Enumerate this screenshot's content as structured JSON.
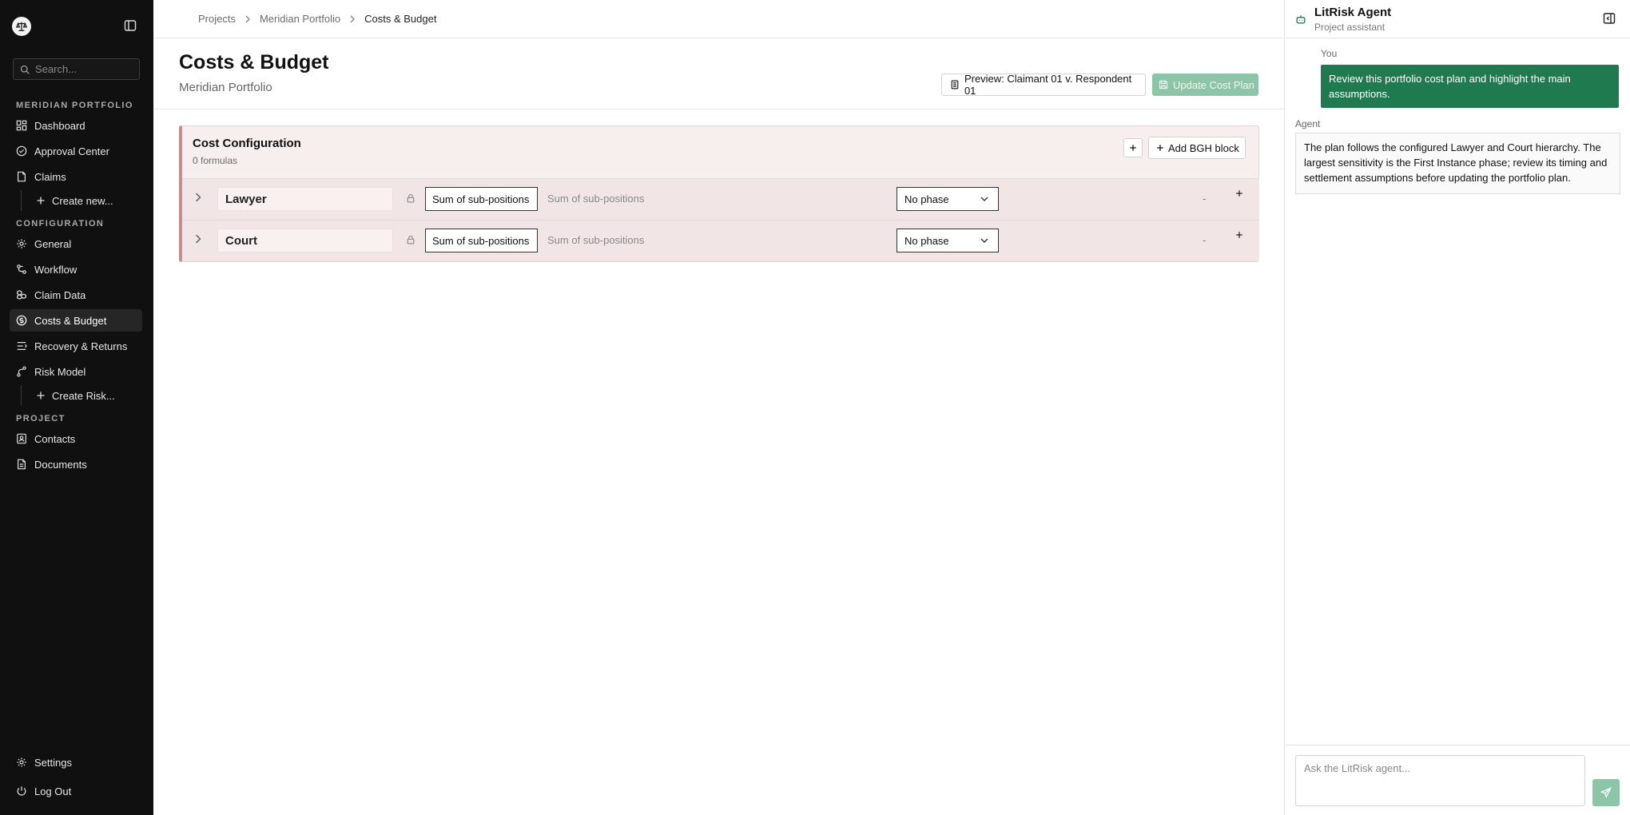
{
  "sidebar": {
    "search_placeholder": "Search...",
    "sections": {
      "portfolio": "MERIDIAN PORTFOLIO",
      "configuration": "CONFIGURATION",
      "project": "PROJECT"
    },
    "items": {
      "dashboard": "Dashboard",
      "approval_center": "Approval Center",
      "claims": "Claims",
      "create_new": "Create new...",
      "general": "General",
      "workflow": "Workflow",
      "claim_data": "Claim Data",
      "costs_budget": "Costs & Budget",
      "recovery_returns": "Recovery & Returns",
      "risk_model": "Risk Model",
      "create_risk": "Create Risk...",
      "contacts": "Contacts",
      "documents": "Documents",
      "settings": "Settings",
      "log_out": "Log Out"
    },
    "active_item": "costs_budget"
  },
  "breadcrumb": [
    "Projects",
    "Meridian Portfolio",
    "Costs & Budget"
  ],
  "header": {
    "title": "Costs & Budget",
    "subtitle": "Meridian Portfolio",
    "preview_label": "Preview: Claimant 01 v. Respondent 01",
    "update_label": "Update Cost Plan"
  },
  "cost_config": {
    "title": "Cost Configuration",
    "formulas_count": "0 formulas",
    "add_block_label": "Add BGH block",
    "rows": [
      {
        "name": "Lawyer",
        "formula": "Sum of sub-positions",
        "formula_desc": "Sum of sub-positions",
        "phase": "No phase",
        "value": "-"
      },
      {
        "name": "Court",
        "formula": "Sum of sub-positions",
        "formula_desc": "Sum of sub-positions",
        "phase": "No phase",
        "value": "-"
      }
    ]
  },
  "agent": {
    "title": "LitRisk Agent",
    "subtitle": "Project assistant",
    "user_label": "You",
    "user_message": "Review this portfolio cost plan and highlight the main assumptions.",
    "agent_label": "Agent",
    "agent_message": "The plan follows the configured Lawyer and Court hierarchy. The largest sensitivity is the First Instance phase; review its timing and settlement assumptions before updating the portfolio plan.",
    "input_placeholder": "Ask the LitRisk agent..."
  },
  "colors": {
    "sidebar_bg": "#101010",
    "accent_green": "#1f7a4f",
    "disabled_green": "#8cc5a8",
    "config_panel_bg": "#f6efee",
    "config_accent": "#c98c8c"
  }
}
